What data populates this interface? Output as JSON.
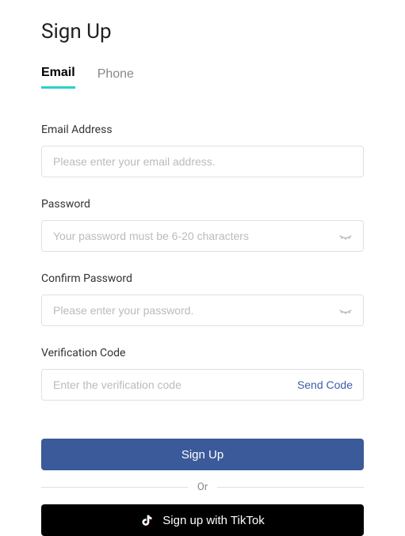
{
  "page": {
    "title": "Sign Up"
  },
  "tabs": {
    "email": "Email",
    "phone": "Phone"
  },
  "fields": {
    "email": {
      "label": "Email Address",
      "placeholder": "Please enter your email address."
    },
    "password": {
      "label": "Password",
      "placeholder": "Your password must be 6-20 characters"
    },
    "confirm_password": {
      "label": "Confirm Password",
      "placeholder": "Please enter your password."
    },
    "verification_code": {
      "label": "Verification Code",
      "placeholder": "Enter the verification code",
      "send_label": "Send Code"
    }
  },
  "buttons": {
    "signup": "Sign Up",
    "tiktok": "Sign up with TikTok"
  },
  "divider": {
    "text": "Or"
  },
  "colors": {
    "primary": "#3a5a99",
    "accent": "#2ad2c9",
    "link": "#3a5fa8",
    "tiktok_bg": "#000000"
  }
}
